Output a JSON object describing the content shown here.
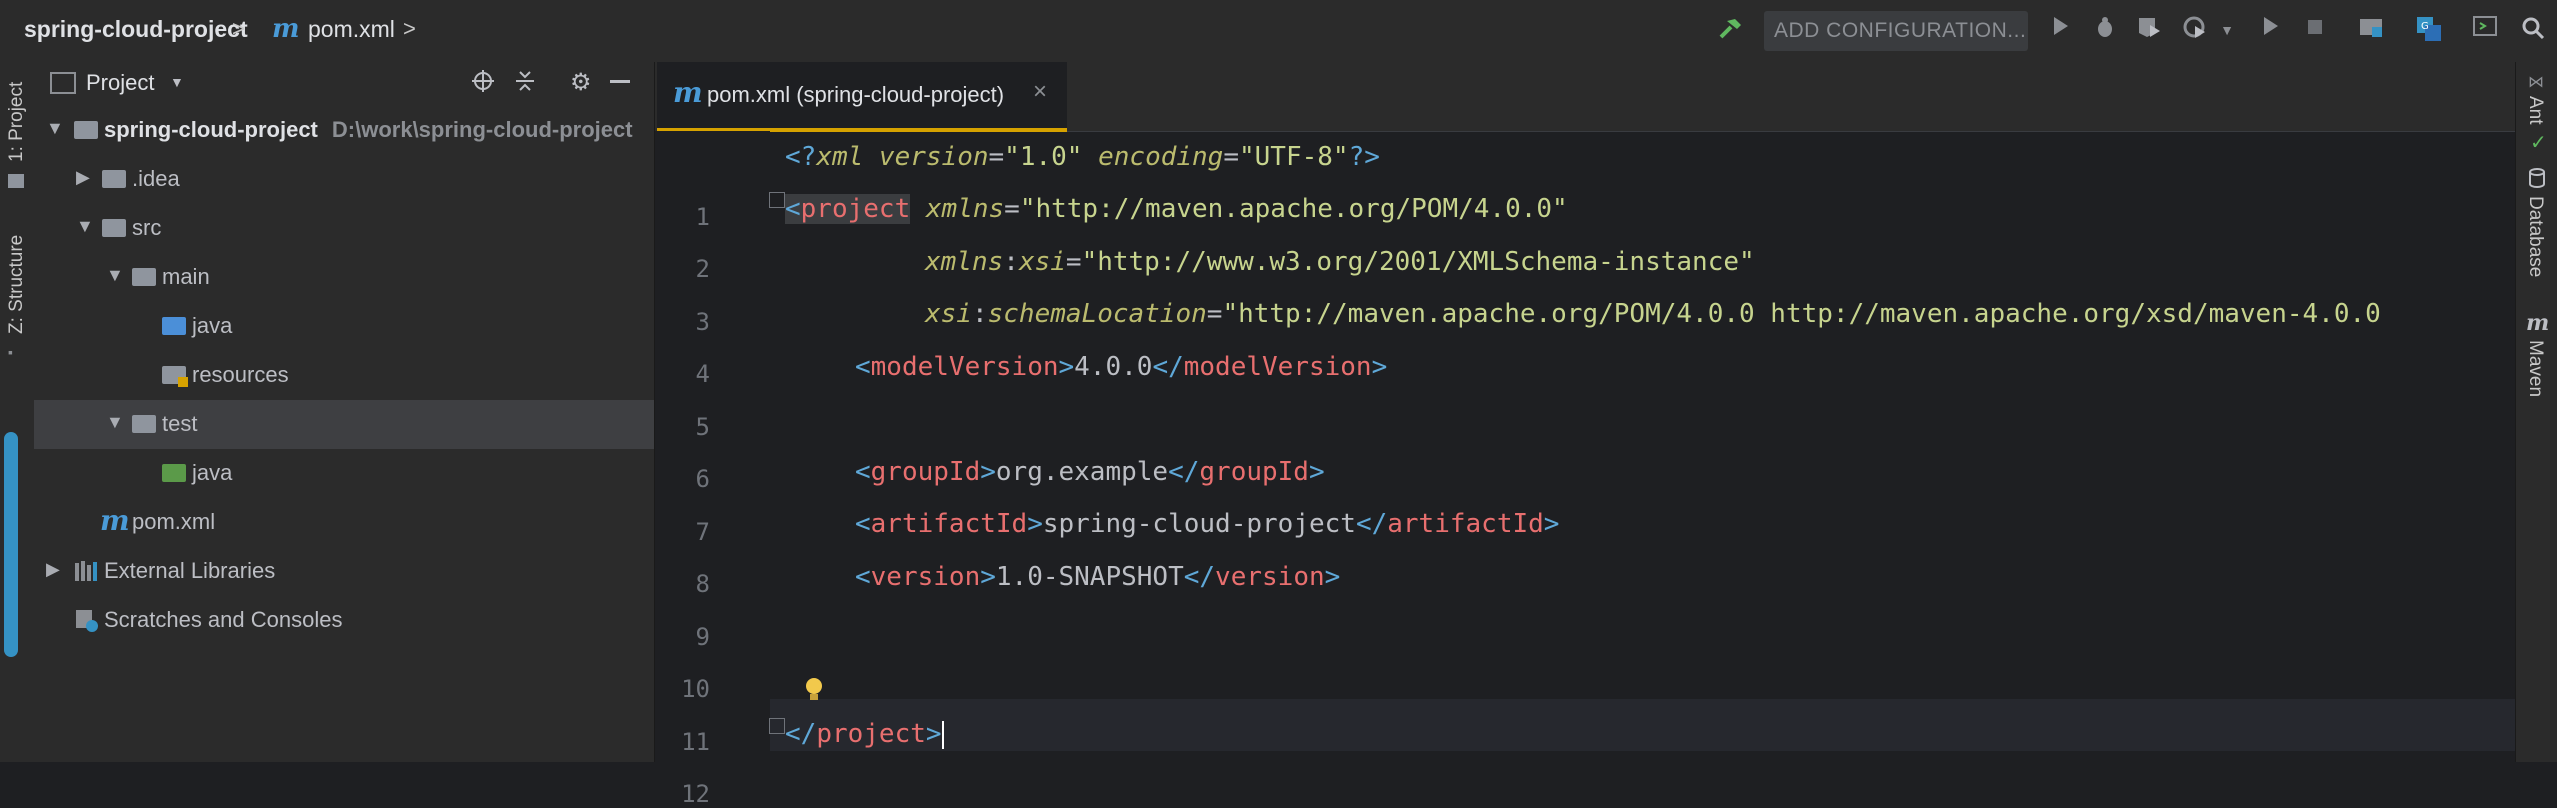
{
  "breadcrumb": {
    "project": "spring-cloud-project",
    "separator": ">",
    "file_icon": "maven-m-icon",
    "file": "pom.xml"
  },
  "toolbar": {
    "run_configuration": "ADD CONFIGURATION...",
    "icons": [
      "build-hammer-icon",
      "run-icon",
      "debug-icon",
      "coverage-icon",
      "profile-icon",
      "run-dropdown-icon",
      "stop-icon",
      "project-structure-icon",
      "translate-icon",
      "terminal-icon",
      "search-icon"
    ]
  },
  "left_strip": {
    "project_tab": "1: Project",
    "structure_tab": "Z: Structure"
  },
  "project_panel": {
    "title": "Project",
    "tree": [
      {
        "label": "spring-cloud-project",
        "path": "D:\\work\\spring-cloud-project",
        "depth": 0,
        "expanded": true,
        "icon": "module-folder-icon"
      },
      {
        "label": ".idea",
        "depth": 1,
        "expanded": false,
        "icon": "folder-icon"
      },
      {
        "label": "src",
        "depth": 1,
        "expanded": true,
        "icon": "folder-icon"
      },
      {
        "label": "main",
        "depth": 2,
        "expanded": true,
        "icon": "folder-icon"
      },
      {
        "label": "java",
        "depth": 3,
        "icon": "source-folder-icon"
      },
      {
        "label": "resources",
        "depth": 3,
        "icon": "resources-folder-icon"
      },
      {
        "label": "test",
        "depth": 2,
        "expanded": true,
        "selected": true,
        "icon": "folder-icon"
      },
      {
        "label": "java",
        "depth": 3,
        "icon": "test-source-folder-icon"
      },
      {
        "label": "pom.xml",
        "depth": 1,
        "icon": "maven-m-icon"
      },
      {
        "label": "External Libraries",
        "depth": 0,
        "expanded": false,
        "icon": "library-icon"
      },
      {
        "label": "Scratches and Consoles",
        "depth": 0,
        "icon": "scratches-icon"
      }
    ]
  },
  "editor": {
    "tab_label": "pom.xml (spring-cloud-project)",
    "tab_close": "×",
    "line_numbers": [
      "1",
      "2",
      "3",
      "4",
      "5",
      "6",
      "7",
      "8",
      "9",
      "10",
      "11",
      "12"
    ],
    "lines": {
      "l1": {
        "a": "<?",
        "b": "xml",
        "c": " version",
        "d": "=",
        "e": "\"1.0\"",
        "f": " encoding",
        "g": "=",
        "h": "\"UTF-8\"",
        "i": "?>"
      },
      "l2": {
        "a": "<",
        "b": "project",
        "c": " xmlns",
        "d": "=",
        "e": "\"http://maven.apache.org/POM/4.0.0\""
      },
      "l3": {
        "a": "xmlns",
        "b": ":",
        "c": "xsi",
        "d": "=",
        "e": "\"http://www.w3.org/2001/XMLSchema-instance\""
      },
      "l4": {
        "a": "xsi",
        "b": ":",
        "c": "schemaLocation",
        "d": "=",
        "e": "\"http://maven.apache.org/POM/4.0.0 http://maven.apache.org/xsd/maven-4.0.0"
      },
      "l5": {
        "open": "<",
        "tag": "modelVersion",
        "close": ">",
        "text": "4.0.0",
        "end_open": "</",
        "end_tag": "modelVersion",
        "end_close": ">"
      },
      "l7": {
        "open": "<",
        "tag": "groupId",
        "close": ">",
        "text": "org.example",
        "end_open": "</",
        "end_tag": "groupId",
        "end_close": ">"
      },
      "l8": {
        "open": "<",
        "tag": "artifactId",
        "close": ">",
        "text": "spring-cloud-project",
        "end_open": "</",
        "end_tag": "artifactId",
        "end_close": ">"
      },
      "l9": {
        "open": "<",
        "tag": "version",
        "close": ">",
        "text": "1.0-SNAPSHOT",
        "end_open": "</",
        "end_tag": "version",
        "end_close": ">"
      },
      "l12": {
        "a": "</",
        "b": "project",
        "c": ">"
      }
    }
  },
  "right_strip": {
    "ant": "Ant",
    "database": "Database",
    "maven": "Maven"
  },
  "colors": {
    "accent_tab_underline": "#d6a200",
    "xml_tag": "#e86f6f",
    "xml_string": "#c7d48e",
    "xml_attr": "#bbbb6e",
    "xml_bracket": "#5fa8d8"
  }
}
